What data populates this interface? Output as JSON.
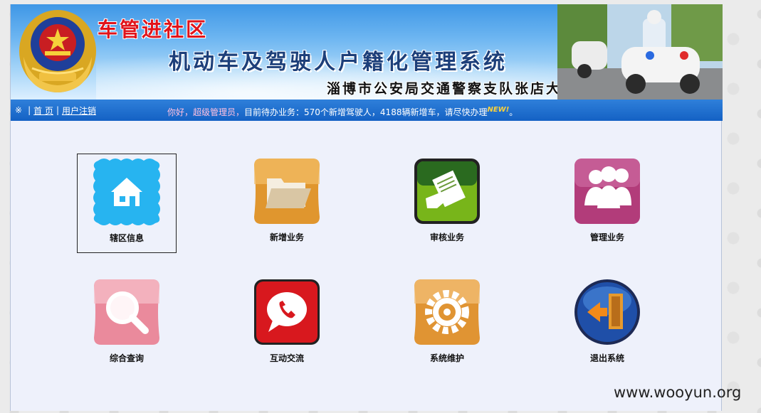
{
  "header": {
    "slogan": "车管进社区",
    "system_title": "机动车及驾驶人户籍化管理系统",
    "department": "淄博市公安局交通警察支队张店大队"
  },
  "nav": {
    "symbol": "※",
    "home_label": "首 页",
    "logout_label": "用户注销",
    "notice_greeting": "你好，超级管理员，",
    "notice_text": "目前待办业务：570个新增驾驶人，4188辆新增车，请尽快办理",
    "notice_new_badge": "NEW!",
    "notice_end": "。"
  },
  "tiles": [
    {
      "label": "辖区信息",
      "icon": "home-icon",
      "color": "#27b4f0"
    },
    {
      "label": "新增业务",
      "icon": "folder-icon",
      "color": "#e0962e"
    },
    {
      "label": "审核业务",
      "icon": "document-review-icon",
      "color": "#78b51a"
    },
    {
      "label": "管理业务",
      "icon": "users-icon",
      "color": "#b23c7a"
    },
    {
      "label": "综合查询",
      "icon": "magnifier-icon",
      "color": "#ea8a9c"
    },
    {
      "label": "互动交流",
      "icon": "phone-chat-icon",
      "color": "#d8181e"
    },
    {
      "label": "系统维护",
      "icon": "gear-icon",
      "color": "#e09433"
    },
    {
      "label": "退出系统",
      "icon": "exit-door-icon",
      "color": "#1f4fa8"
    }
  ],
  "watermark": "www.wooyun.org"
}
